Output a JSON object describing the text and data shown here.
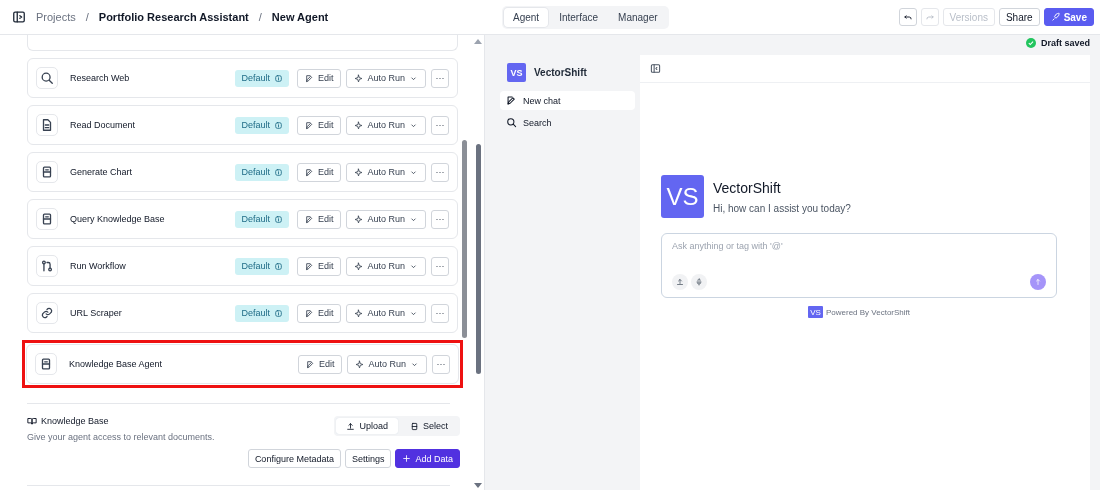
{
  "breadcrumbs": [
    {
      "label": "Projects",
      "muted": true
    },
    {
      "label": "Portfolio Research Assistant",
      "muted": false
    },
    {
      "label": "New Agent",
      "muted": false
    }
  ],
  "breadcrumb_separators": [
    "/",
    "/"
  ],
  "tabs": [
    {
      "label": "Agent",
      "selected": true
    },
    {
      "label": "Interface",
      "selected": false
    },
    {
      "label": "Manager",
      "selected": false
    }
  ],
  "history": {
    "undo_disabled": false,
    "redo_disabled": true
  },
  "header_buttons": [
    {
      "label": "Versions",
      "kind": "plain",
      "disabled": true
    },
    {
      "label": "Share",
      "kind": "plain",
      "disabled": false
    },
    {
      "label": "Save",
      "kind": "primary",
      "disabled": false
    }
  ],
  "status": "Draft saved",
  "tools": [
    {
      "name": "Research Web",
      "kind": "search",
      "badge": "Default",
      "edit": "Edit",
      "run": "Auto Run",
      "more": "···",
      "highlighted": false
    },
    {
      "name": "Read Document",
      "kind": "document",
      "badge": "Default",
      "edit": "Edit",
      "run": "Auto Run",
      "more": "···",
      "highlighted": false
    },
    {
      "name": "Generate Chart",
      "kind": "database",
      "badge": "Default",
      "edit": "Edit",
      "run": "Auto Run",
      "more": "···",
      "highlighted": false
    },
    {
      "name": "Query Knowledge Base",
      "kind": "database",
      "badge": "Default",
      "edit": "Edit",
      "run": "Auto Run",
      "more": "···",
      "highlighted": false
    },
    {
      "name": "Run Workflow",
      "kind": "workflow",
      "badge": "Default",
      "edit": "Edit",
      "run": "Auto Run",
      "more": "···",
      "highlighted": false
    },
    {
      "name": "URL Scraper",
      "kind": "link",
      "badge": "Default",
      "edit": "Edit",
      "run": "Auto Run",
      "more": "···",
      "highlighted": false
    },
    {
      "name": "Knowledge Base Agent",
      "kind": "database",
      "edit": "Edit",
      "run": "Auto Run",
      "more": "···",
      "highlighted": true
    }
  ],
  "knowledge_base": {
    "title": "Knowledge Base",
    "description": "Give your agent access to relevant documents.",
    "source_tabs": [
      {
        "label": "Upload",
        "kind": "upload",
        "selected": true
      },
      {
        "label": "Select",
        "kind": "select",
        "selected": false
      }
    ],
    "actions": [
      {
        "label": "Configure Metadata",
        "kind": "plain"
      },
      {
        "label": "Settings",
        "kind": "plain"
      },
      {
        "label": "Add Data",
        "kind": "primary"
      }
    ]
  },
  "chat": {
    "logo": "VS",
    "brand": "VectorShift",
    "nav": [
      {
        "label": "New chat",
        "kind": "new",
        "selected": true
      },
      {
        "label": "Search",
        "kind": "search",
        "selected": false
      }
    ],
    "welcome_logo": "VS",
    "welcome_title": "VectorShift",
    "welcome_text": "Hi, how can I assist you today?",
    "input": {
      "placeholder": "Ask anything or tag with '@'"
    },
    "footer_logo": "VS",
    "footer": "Powered By VectorShift"
  }
}
